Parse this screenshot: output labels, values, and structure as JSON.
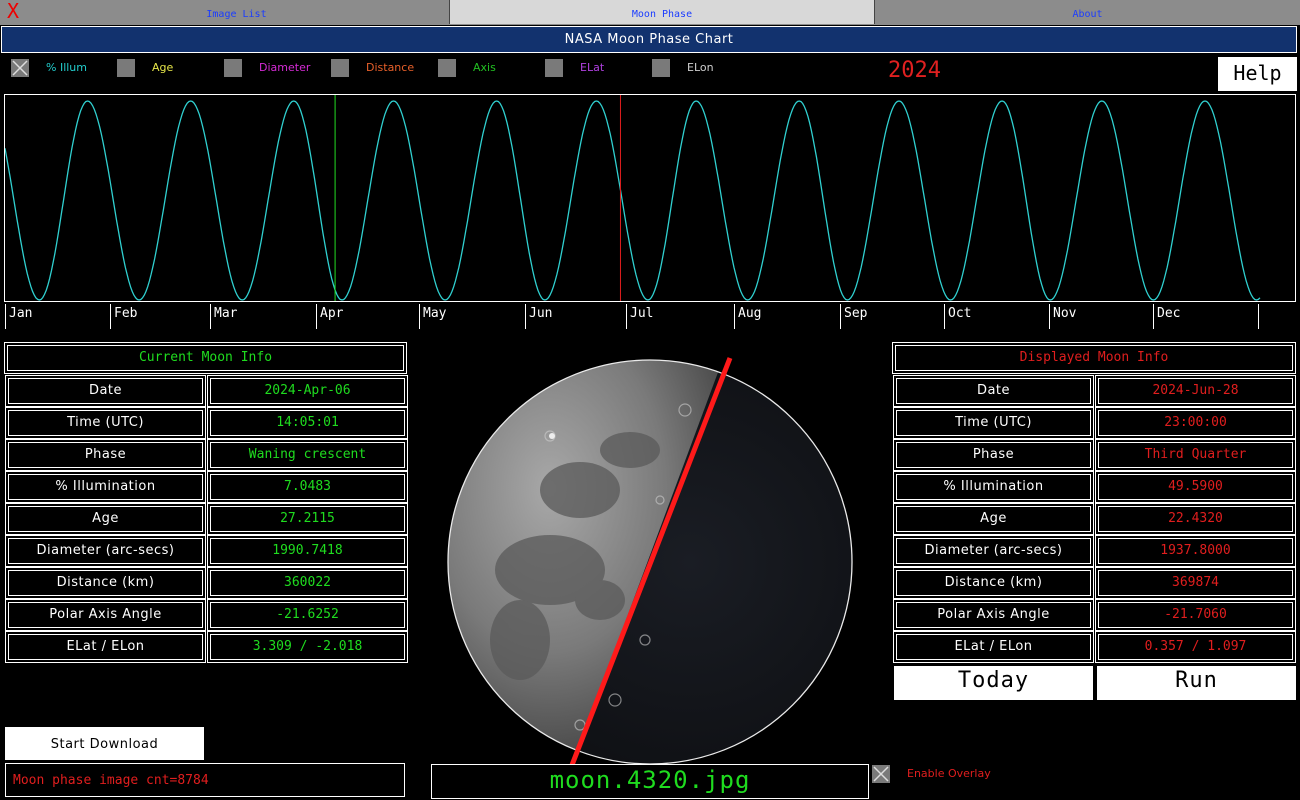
{
  "tabs": [
    {
      "label": "Image List"
    },
    {
      "label": "Moon Phase"
    },
    {
      "label": "About"
    }
  ],
  "close_glyph": "X",
  "title": "NASA Moon Phase Chart",
  "checkboxes": [
    {
      "label": "% Illum",
      "checked": true,
      "color": "#22cccc"
    },
    {
      "label": "Age",
      "checked": false,
      "color": "#e8e84a"
    },
    {
      "label": "Diameter",
      "checked": false,
      "color": "#d62bd6"
    },
    {
      "label": "Distance",
      "checked": false,
      "color": "#e8602a"
    },
    {
      "label": "Axis",
      "checked": false,
      "color": "#22c022"
    },
    {
      "label": "ELat",
      "checked": false,
      "color": "#b040e0"
    },
    {
      "label": "ELon",
      "checked": false,
      "color": "#cfcfcf"
    }
  ],
  "year": "2024",
  "help_label": "Help",
  "months": [
    "Jan",
    "Feb",
    "Mar",
    "Apr",
    "May",
    "Jun",
    "Jul",
    "Aug",
    "Sep",
    "Oct",
    "Nov",
    "Dec"
  ],
  "chart_data": {
    "type": "line",
    "xlabel": "",
    "ylabel": "",
    "x_unit": "day-of-year",
    "xlim": [
      1,
      366
    ],
    "ylim": [
      0,
      100
    ],
    "series": [
      {
        "name": "% Illum",
        "color": "#30d0d0",
        "full_moons_doy": [
          25,
          55,
          85,
          114,
          144,
          173,
          202,
          232,
          261,
          291,
          320,
          350
        ],
        "new_moons_doy": [
          11,
          40,
          70,
          99,
          129,
          158,
          188,
          217,
          246,
          276,
          305,
          335,
          365
        ]
      }
    ],
    "markers": [
      {
        "label": "current",
        "day_of_year": 97,
        "color": "#22dd22"
      },
      {
        "label": "displayed",
        "day_of_year": 180,
        "color": "#e01e1e"
      }
    ],
    "grid": false
  },
  "current": {
    "header": "Current Moon Info",
    "rows": [
      {
        "label": "Date",
        "value": "2024-Apr-06"
      },
      {
        "label": "Time (UTC)",
        "value": "14:05:01"
      },
      {
        "label": "Phase",
        "value": "Waning crescent"
      },
      {
        "label": "% Illumination",
        "value": "7.0483"
      },
      {
        "label": "Age",
        "value": "27.2115"
      },
      {
        "label": "Diameter (arc-secs)",
        "value": "1990.7418"
      },
      {
        "label": "Distance (km)",
        "value": "360022"
      },
      {
        "label": "Polar Axis Angle",
        "value": "-21.6252"
      },
      {
        "label": "ELat / ELon",
        "value": "3.309 / -2.018"
      }
    ]
  },
  "displayed": {
    "header": "Displayed Moon Info",
    "rows": [
      {
        "label": "Date",
        "value": "2024-Jun-28"
      },
      {
        "label": "Time (UTC)",
        "value": "23:00:00"
      },
      {
        "label": "Phase",
        "value": "Third Quarter"
      },
      {
        "label": "% Illumination",
        "value": "49.5900"
      },
      {
        "label": "Age",
        "value": "22.4320"
      },
      {
        "label": "Diameter (arc-secs)",
        "value": "1937.8000"
      },
      {
        "label": "Distance (km)",
        "value": "369874"
      },
      {
        "label": "Polar Axis Angle",
        "value": "-21.7060"
      },
      {
        "label": "ELat / ELon",
        "value": "0.357 / 1.097"
      }
    ]
  },
  "today_label": "Today",
  "run_label": "Run",
  "download_label": "Start Download",
  "status_text": "Moon phase image cnt=8784",
  "filename": "moon.4320.jpg",
  "overlay": {
    "label": "Enable Overlay",
    "checked": true
  },
  "colors": {
    "current": "#1fdc1f",
    "displayed": "#e01e1e",
    "title_bg": "#12326e"
  }
}
